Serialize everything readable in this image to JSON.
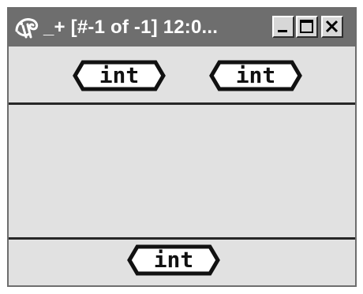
{
  "window": {
    "title": "_+ [#-1 of -1]  12:0...",
    "controls": {
      "minimize_icon": "minimize-icon",
      "maximize_icon": "maximize-icon",
      "close_icon": "close-icon"
    }
  },
  "top_pane": {
    "tags": [
      {
        "label": "int"
      },
      {
        "label": "int"
      }
    ]
  },
  "bottom_pane": {
    "tags": [
      {
        "label": "int"
      }
    ]
  },
  "colors": {
    "titlebar": "#6e6e6e",
    "window_background": "#e1e1e1",
    "divider": "#262626",
    "tag_border": "#111111",
    "tag_fill": "#ffffff"
  }
}
